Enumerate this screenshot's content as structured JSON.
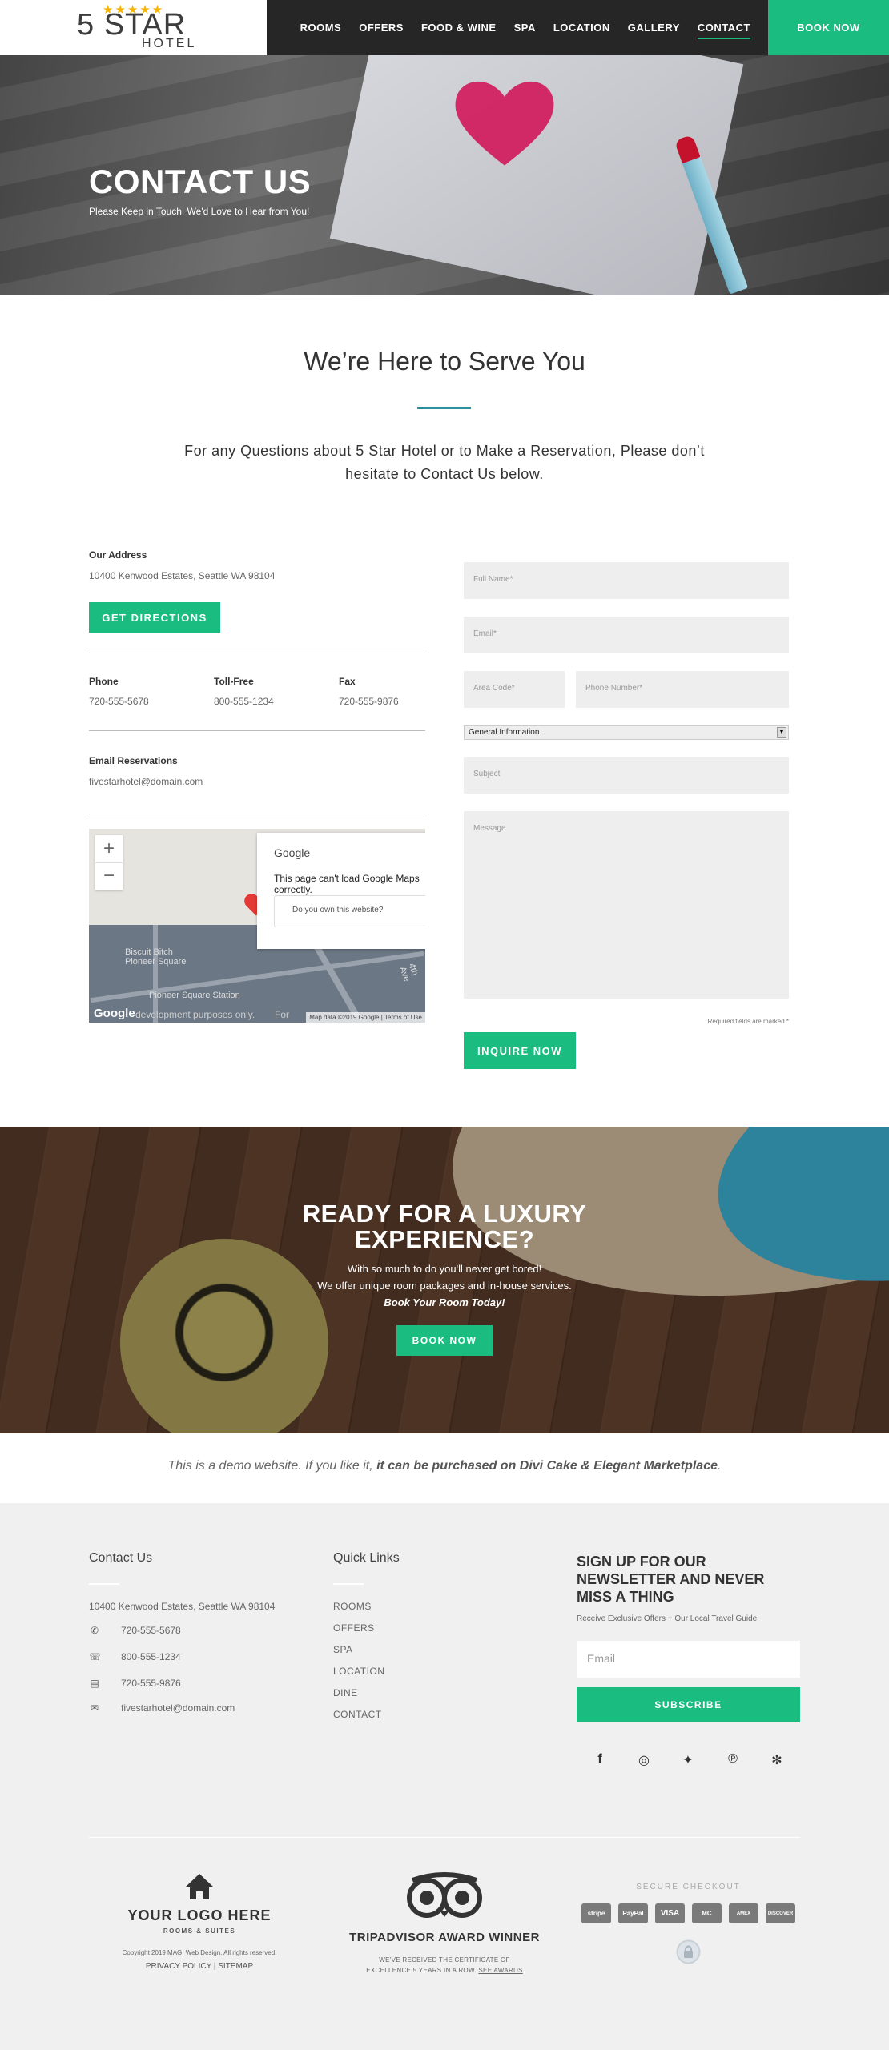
{
  "header": {
    "logo_main": "5 STAR",
    "logo_sub": "HOTEL",
    "stars": "★★★★★",
    "nav": [
      "ROOMS",
      "OFFERS",
      "FOOD & WINE",
      "SPA",
      "LOCATION",
      "GALLERY",
      "CONTACT"
    ],
    "active_nav": "CONTACT",
    "book_label": "BOOK NOW"
  },
  "hero": {
    "title": "CONTACT US",
    "subtitle": "Please Keep in Touch, We'd Love to Hear from You!"
  },
  "intro": {
    "title": "We’re Here to Serve You",
    "text": "For any Questions about 5 Star Hotel or to Make a Reservation, Please don’t hesitate to Contact Us below."
  },
  "contact": {
    "address_label": "Our Address",
    "address": "10400 Kenwood Estates, Seattle WA 98104",
    "directions_label": "GET DIRECTIONS",
    "phone_label": "Phone",
    "phone": "720-555-5678",
    "tollfree_label": "Toll-Free",
    "tollfree": "800-555-1234",
    "fax_label": "Fax",
    "fax": "720-555-9876",
    "email_label": "Email Reservations",
    "email": "fivestarhotel@domain.com"
  },
  "map": {
    "zoom_in": "+",
    "zoom_out": "−",
    "dialog_logo": "Google",
    "dialog_message": "This page can't load Google Maps correctly.",
    "dialog_button": "Do you own this website?",
    "label_1": "Biscuit Bitch Pioneer Square",
    "label_2": "Pioneer Square Station",
    "label_3": "4th Ave",
    "watermark": "Google",
    "dev_text": "development purposes only.",
    "for_text": "For",
    "data_text": "Map data ©2019 Google | Terms of Use"
  },
  "form": {
    "full_name": "Full Name*",
    "email": "Email*",
    "area_code": "Area Code*",
    "phone": "Phone Number*",
    "select_value": "General Information",
    "subject": "Subject",
    "message": "Message",
    "required_note": "Required fields are marked *",
    "submit_label": "INQUIRE NOW"
  },
  "luxury": {
    "title": "READY FOR A LUXURY EXPERIENCE?",
    "line1": "With so much to do you'll never get bored!",
    "line2": "We offer unique room packages and in-house services.",
    "line3": "Book Your Room Today!",
    "button": "BOOK NOW"
  },
  "demo": {
    "text": "This is a demo website. If you like it, ",
    "bold": "it can be purchased on Divi Cake & Elegant Marketplace",
    "end": "."
  },
  "footer": {
    "contact_title": "Contact Us",
    "address": "10400 Kenwood Estates, Seattle WA 98104",
    "phone": "720-555-5678",
    "tollfree": "800-555-1234",
    "fax": "720-555-9876",
    "email": "fivestarhotel@domain.com",
    "links_title": "Quick Links",
    "links": [
      "ROOMS",
      "OFFERS",
      "SPA",
      "LOCATION",
      "DINE",
      "CONTACT"
    ],
    "newsletter_title": "SIGN UP FOR OUR NEWSLETTER AND NEVER MISS A THING",
    "newsletter_sub": "Receive Exclusive Offers + Our Local Travel Guide",
    "email_placeholder": "Email",
    "subscribe_label": "SUBSCRIBE",
    "social_icons": [
      "facebook-icon",
      "instagram-icon",
      "twitter-icon",
      "pinterest-icon",
      "yelp-icon"
    ],
    "logo_title": "YOUR LOGO HERE",
    "logo_sub": "ROOMS & SUITES",
    "copyright": "Copyright 2019 MAGI Web Design. All rights reserved.",
    "privacy": "PRIVACY POLICY | SITEMAP",
    "award_title": "TRIPADVISOR AWARD WINNER",
    "award_line1": "WE'VE RECEIVED THE CERTIFICATE OF",
    "award_line2": "EXCELLENCE 5 YEARS IN A ROW.",
    "award_link": "SEE AWARDS",
    "secure_title": "SECURE CHECKOUT",
    "payment_methods": [
      "stripe",
      "PayPal",
      "VISA",
      "MC",
      "AMEX",
      "DISCOVER"
    ]
  },
  "colors": {
    "accent": "#1abc7f",
    "nav_bg": "#262626",
    "divider_teal": "#2b8f9f",
    "footer_bg": "#f0f0f0"
  }
}
